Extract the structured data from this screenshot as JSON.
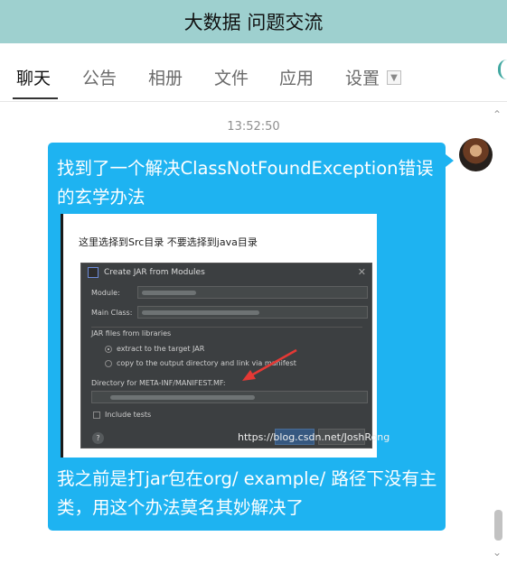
{
  "window": {
    "title": "大数据 问题交流"
  },
  "tabs": [
    {
      "label": "聊天",
      "active": true
    },
    {
      "label": "公告"
    },
    {
      "label": "相册"
    },
    {
      "label": "文件"
    },
    {
      "label": "应用"
    },
    {
      "label": "设置"
    }
  ],
  "chat": {
    "timestamp": "13:52:50",
    "message": {
      "text_top": "找到了一个解决ClassNotFoundException错误的玄学办法",
      "text_bottom": "我之前是打jar包在org/ example/ 路径下没有主类，用这个办法莫名其妙解决了",
      "bubble_color": "#1eb3f1"
    },
    "embedded_image": {
      "caption": "这里选择到Src目录 不要选择到java目录",
      "dialog": {
        "title": "Create JAR from Modules",
        "module_label": "Module:",
        "main_class_label": "Main Class:",
        "jar_section_label": "JAR files from libraries",
        "option_extract": "extract to the target JAR",
        "option_copy": "copy to the output directory and link via manifest",
        "manifest_dir_label": "Directory for META-INF/MANIFEST.MF:",
        "include_tests_label": "Include tests",
        "help_glyph": "?"
      },
      "watermark": "https://blog.csdn.net/JoshRong"
    }
  },
  "icons": {
    "settings_dropdown": "chevron-down-icon",
    "scroll_up": "chevron-up-icon",
    "scroll_down": "chevron-down-icon"
  },
  "colors": {
    "title_bar": "#9ed0cf",
    "bubble": "#1eb3f1",
    "dialog_bg": "#3c3f41"
  }
}
